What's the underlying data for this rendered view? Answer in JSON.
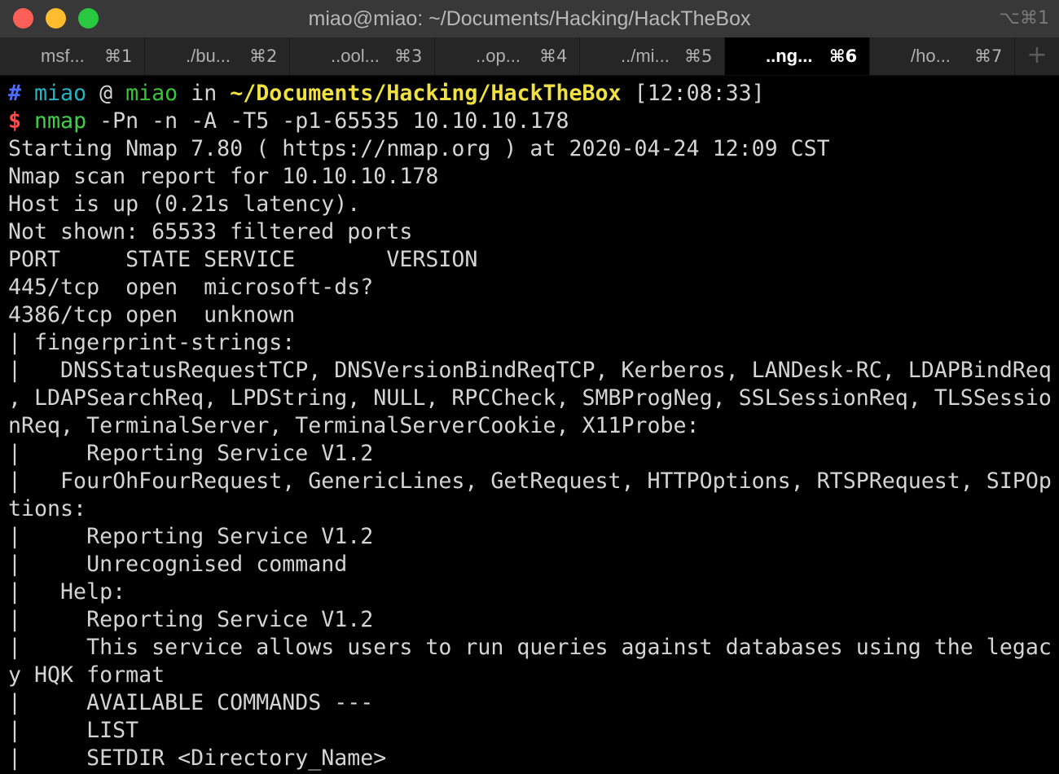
{
  "window": {
    "title": "miao@miao: ~/Documents/Hacking/HackTheBox",
    "shortcut": "⌥⌘1",
    "colors": {
      "red": "#ff5f57",
      "yellow": "#febc2e",
      "green": "#28c840"
    }
  },
  "tabs": [
    {
      "label": "msf...",
      "key": "⌘1",
      "active": false
    },
    {
      "label": "./bu...",
      "key": "⌘2",
      "active": false
    },
    {
      "label": "..ool...",
      "key": "⌘3",
      "active": false
    },
    {
      "label": "..op...",
      "key": "⌘4",
      "active": false
    },
    {
      "label": "../mi...",
      "key": "⌘5",
      "active": false
    },
    {
      "label": "..ng...",
      "key": "⌘6",
      "active": true
    },
    {
      "label": "/ho...",
      "key": "⌘7",
      "active": false
    }
  ],
  "new_tab": "+",
  "prompt": {
    "hash": "#",
    "user": "miao",
    "at": "@",
    "host": "miao",
    "in": "in",
    "path": "~/Documents/Hacking/HackTheBox",
    "time": "[12:08:33]",
    "dollar": "$",
    "command": "nmap",
    "args": "-Pn -n -A -T5 -p1-65535 10.10.10.178"
  },
  "output": [
    "Starting Nmap 7.80 ( https://nmap.org ) at 2020-04-24 12:09 CST",
    "Nmap scan report for 10.10.10.178",
    "Host is up (0.21s latency).",
    "Not shown: 65533 filtered ports",
    "PORT     STATE SERVICE       VERSION",
    "445/tcp  open  microsoft-ds?",
    "4386/tcp open  unknown",
    "| fingerprint-strings:",
    "|   DNSStatusRequestTCP, DNSVersionBindReqTCP, Kerberos, LANDesk-RC, LDAPBindReq",
    ", LDAPSearchReq, LPDString, NULL, RPCCheck, SMBProgNeg, SSLSessionReq, TLSSessio",
    "nReq, TerminalServer, TerminalServerCookie, X11Probe:",
    "|     Reporting Service V1.2",
    "|   FourOhFourRequest, GenericLines, GetRequest, HTTPOptions, RTSPRequest, SIPOp",
    "tions:",
    "|     Reporting Service V1.2",
    "|     Unrecognised command",
    "|   Help:",
    "|     Reporting Service V1.2",
    "|     This service allows users to run queries against databases using the legac",
    "y HQK format",
    "|     AVAILABLE COMMANDS ---",
    "|     LIST",
    "|     SETDIR <Directory_Name>"
  ]
}
